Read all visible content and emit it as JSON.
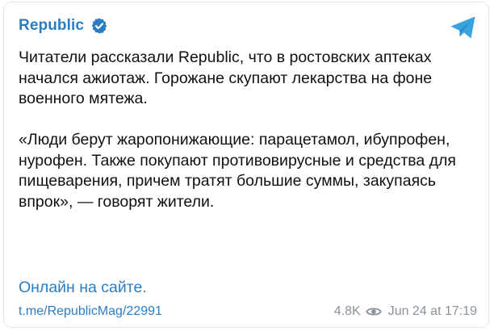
{
  "channel": {
    "name": "Republic",
    "verified": true
  },
  "post": {
    "paragraphs": [
      "Читатели рассказали Republic, что в ростовских аптеках начался ажиотаж. Горожане скупают лекарства на фоне военного мятежа.",
      "«Люди берут жаропонижающие: парацетамол, ибупрофен, нурофен. Также покупают противовирусные и средства для пищеварения, причем тратят большие суммы, закупаясь впрок», — говорят жители."
    ],
    "site_link": "Онлайн на сайте.",
    "post_link": "t.me/RepublicMag/22991",
    "views": "4.8K",
    "date": "Jun 24 at 17:19"
  },
  "colors": {
    "accent": "#2a7dc3",
    "telegram": "#37a4e0",
    "muted": "#8a929c"
  },
  "icons": {
    "verified": "verified-badge-icon",
    "views": "eye-icon",
    "brand": "telegram-logo-icon"
  }
}
